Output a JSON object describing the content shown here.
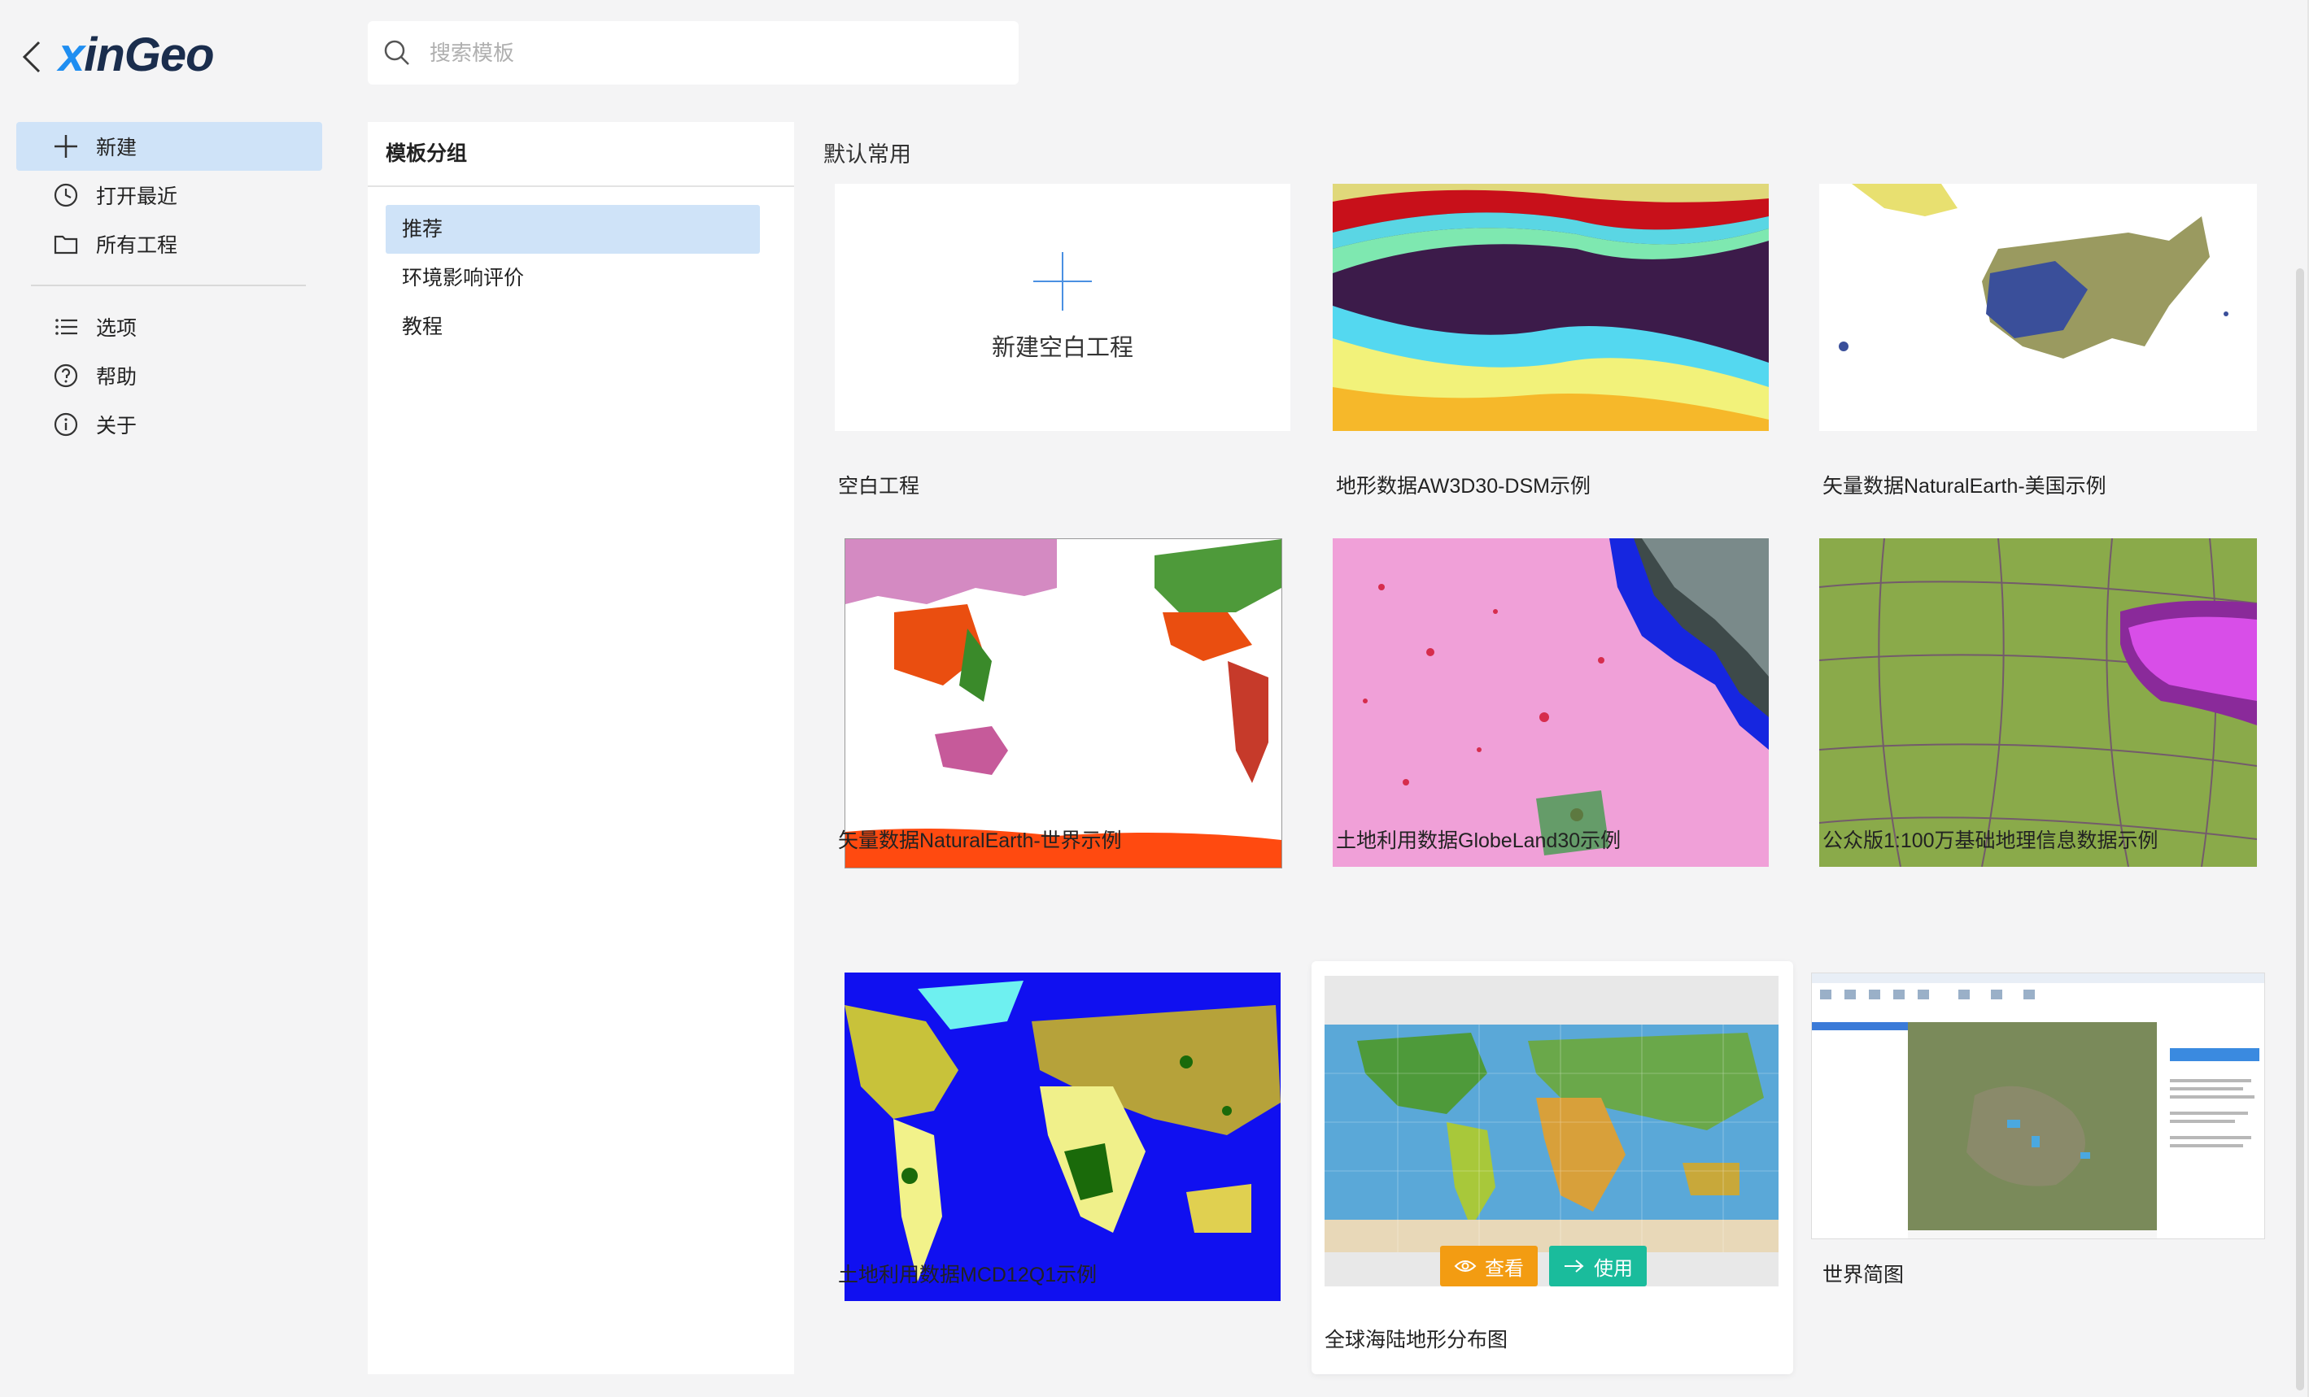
{
  "app": {
    "logo_prefix": "x",
    "logo_rest": "inGeo"
  },
  "search": {
    "placeholder": "搜索模板"
  },
  "nav": {
    "items": [
      {
        "label": "新建",
        "icon": "plus-icon"
      },
      {
        "label": "打开最近",
        "icon": "clock-icon"
      },
      {
        "label": "所有工程",
        "icon": "folder-icon"
      },
      {
        "label": "选项",
        "icon": "list-icon"
      },
      {
        "label": "帮助",
        "icon": "help-icon"
      },
      {
        "label": "关于",
        "icon": "info-icon"
      }
    ]
  },
  "groups": {
    "title": "模板分组",
    "items": [
      {
        "label": "推荐"
      },
      {
        "label": "环境影响评价"
      },
      {
        "label": "教程"
      }
    ]
  },
  "templates": {
    "section_title": "默认常用",
    "blank_card_text": "新建空白工程",
    "cards": [
      {
        "label": "空白工程"
      },
      {
        "label": "地形数据AW3D30-DSM示例"
      },
      {
        "label": "矢量数据NaturalEarth-美国示例"
      },
      {
        "label": "矢量数据NaturalEarth-世界示例"
      },
      {
        "label": "土地利用数据GlobeLand30示例"
      },
      {
        "label": "公众版1:100万基础地理信息数据示例"
      },
      {
        "label": "土地利用数据MCD12Q1示例"
      },
      {
        "label": "全球海陆地形分布图"
      },
      {
        "label": "世界简图"
      }
    ],
    "view_label": "查看",
    "use_label": "使用"
  },
  "colors": {
    "accent": "#1f8ef1",
    "selected_bg": "#cfe3f8",
    "view_btn": "#f39c12",
    "use_btn": "#1abc9c"
  }
}
